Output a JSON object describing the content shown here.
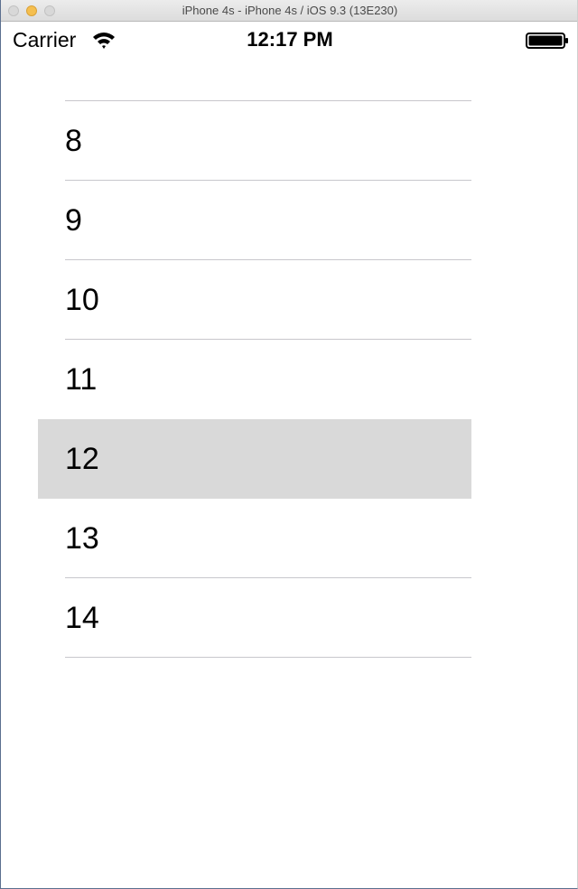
{
  "window": {
    "title": "iPhone 4s - iPhone 4s / iOS 9.3 (13E230)"
  },
  "status_bar": {
    "carrier": "Carrier",
    "time": "12:17 PM",
    "wifi_icon": "wifi-icon",
    "battery_icon": "battery-icon"
  },
  "table": {
    "rows": [
      {
        "label": "8"
      },
      {
        "label": "9"
      },
      {
        "label": "10"
      },
      {
        "label": "11"
      },
      {
        "label": "12",
        "selected": true
      },
      {
        "label": "13"
      },
      {
        "label": "14"
      }
    ]
  },
  "colors": {
    "selected_row_bg": "#d9d9d9",
    "separator": "#c8c7cc"
  }
}
